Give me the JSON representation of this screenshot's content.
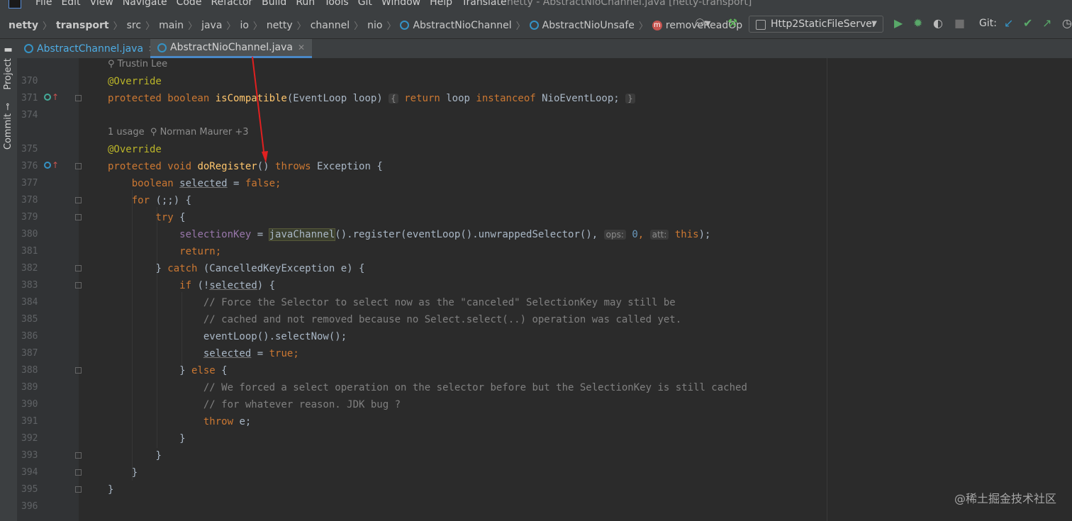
{
  "menubar": {
    "items": [
      "File",
      "Edit",
      "View",
      "Navigate",
      "Code",
      "Refactor",
      "Build",
      "Run",
      "Tools",
      "Git",
      "Window",
      "Help",
      "Translate"
    ],
    "window_title": "netty - AbstractNioChannel.java [netty-transport]"
  },
  "breadcrumb": {
    "items": [
      "netty",
      "transport",
      "src",
      "main",
      "java",
      "io",
      "netty",
      "channel",
      "nio",
      "AbstractNioChannel",
      "AbstractNioUnsafe",
      "removeReadOp"
    ]
  },
  "toolbar": {
    "run_config": "Http2StaticFileServer",
    "git_label": "Git:"
  },
  "tabs": [
    {
      "label": "AbstractChannel.java",
      "active": false
    },
    {
      "label": "AbstractNioChannel.java",
      "active": true
    }
  ],
  "sidebar": {
    "project_label": "Project",
    "commit_label": "Commit"
  },
  "hints": {
    "author1": "Trustin Lee",
    "usage": "1 usage",
    "author2": "Norman Maurer +3"
  },
  "line_numbers": [
    "370",
    "371",
    "374",
    "375",
    "376",
    "377",
    "378",
    "379",
    "380",
    "381",
    "382",
    "383",
    "384",
    "385",
    "386",
    "387",
    "388",
    "389",
    "390",
    "391",
    "392",
    "393",
    "394",
    "395",
    "396"
  ],
  "code": {
    "override": "@Override",
    "compat_mod": "protected boolean ",
    "compat_name": "isCompatible",
    "compat_params": "(EventLoop loop) ",
    "compat_open": "{",
    "compat_ret": "return",
    "compat_loop": " loop ",
    "compat_inst": "instanceof",
    "compat_type": " NioEventLoop;",
    "compat_close": "}",
    "reg_mod": "protected void ",
    "reg_name": "doRegister",
    "reg_paren": "() ",
    "reg_throws": "throws",
    "reg_exc": " Exception {",
    "bool_kw": "boolean ",
    "selected": "selected",
    "eq_false": " = ",
    "false": "false",
    "semi": ";",
    "for_kw": "for",
    "for_rest": " (;;) {",
    "try_kw": "try",
    "brace_open": " {",
    "selkey": "selectionKey",
    "eq": " = ",
    "javaChannel": "javaChannel",
    "register": "().register(eventLoop().unwrappedSelector(), ",
    "ops_hint": "ops:",
    "zero": "0",
    "comma": ", ",
    "att_hint": "att:",
    "this_kw": "this",
    "close_stmt": ");",
    "return_kw": "return",
    "catch_close": "} ",
    "catch_kw": "catch",
    "catch_rest": " (CancelledKeyException e) {",
    "if_kw": "if",
    "if_open": " (!",
    "if_close": ") {",
    "comment1": "// Force the Selector to select now as the \"canceled\" SelectionKey may still be",
    "comment2": "// cached and not removed because no Select.select(..) operation was called yet.",
    "selectNow": "eventLoop().selectNow();",
    "true": "true",
    "else_close": "} ",
    "else_kw": "else",
    "comment3": "// We forced a select operation on the selector before but the SelectionKey is still cached",
    "comment4": "// for whatever reason. JDK bug ?",
    "throw_kw": "throw",
    "throw_rest": " e;",
    "rbrace": "}"
  },
  "watermark": "@稀土掘金技术社区",
  "colors": {
    "background": "#2b2b2b",
    "keyword": "#cc7832",
    "annotation": "#bbb529",
    "method": "#ffc66d",
    "field": "#9876aa",
    "comment": "#808080",
    "arrow": "#e02020"
  }
}
